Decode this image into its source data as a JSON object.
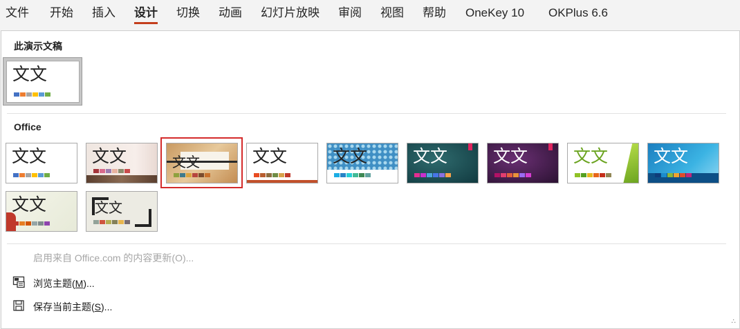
{
  "tabs": [
    "文件",
    "开始",
    "插入",
    "设计",
    "切换",
    "动画",
    "幻灯片放映",
    "审阅",
    "视图",
    "帮助",
    "OneKey 10",
    "OKPlus 6.6"
  ],
  "active_tab": "设计",
  "sections": {
    "this_presentation": "此演示文稿",
    "office": "Office"
  },
  "theme_sample_text": "文文",
  "themes": [
    {
      "name": "office-theme-default",
      "colors": [
        "#4472c4",
        "#ed7d31",
        "#a5a5a5",
        "#ffc000",
        "#5b9bd5",
        "#70ad47"
      ]
    },
    {
      "name": "theme-office-white",
      "colors": [
        "#4472c4",
        "#ed7d31",
        "#a5a5a5",
        "#ffc000",
        "#5b9bd5",
        "#70ad47"
      ]
    },
    {
      "name": "theme-wood-pink",
      "colors": [
        "#a4343a",
        "#d86a8c",
        "#9b7bb0",
        "#e8b3a0",
        "#8c8c6d",
        "#c94b4b"
      ]
    },
    {
      "name": "theme-wood-board",
      "colors": [
        "#8fa13e",
        "#3e7a8c",
        "#d9a33d",
        "#b6453d",
        "#7a4b2e",
        "#c9712c"
      ]
    },
    {
      "name": "theme-ion-boardroom",
      "colors": [
        "#e84c22",
        "#b85e2f",
        "#8c6d3f",
        "#6f8c45",
        "#d8a24a",
        "#c0392b"
      ]
    },
    {
      "name": "theme-blue-pattern",
      "colors": [
        "#1cade4",
        "#2683c6",
        "#27ced7",
        "#42ba97",
        "#3e8853",
        "#62a39f"
      ]
    },
    {
      "name": "theme-teal-dark",
      "colors": [
        "#e32d91",
        "#c830cc",
        "#4ea6dc",
        "#4775e7",
        "#8971e1",
        "#f8a24b"
      ]
    },
    {
      "name": "theme-purple-dark",
      "colors": [
        "#b31166",
        "#e33d6f",
        "#e45f3c",
        "#e9943a",
        "#9b6bf2",
        "#d53dd0"
      ]
    },
    {
      "name": "theme-green-facet",
      "colors": [
        "#90c226",
        "#54a021",
        "#e6b91e",
        "#e76618",
        "#c42f1a",
        "#918655"
      ]
    },
    {
      "name": "theme-blue-gradient",
      "colors": [
        "#0f3d7a",
        "#1c8ccd",
        "#8cb83a",
        "#f0a22e",
        "#de4c2b",
        "#c0267a"
      ]
    },
    {
      "name": "theme-savon",
      "colors": [
        "#c0392b",
        "#e67e22",
        "#d35400",
        "#95a5a6",
        "#7f8c8d",
        "#8e44ad"
      ]
    },
    {
      "name": "theme-frame-dark",
      "colors": [
        "#93a299",
        "#cf543f",
        "#b5ae53",
        "#848058",
        "#e8b54d",
        "#786c71"
      ]
    }
  ],
  "menu": {
    "enable_updates": "启用来自 Office.com 的内容更新(O)...",
    "browse_themes_prefix": "浏览主题(",
    "browse_themes_key": "M",
    "browse_themes_suffix": ")...",
    "save_theme_prefix": "保存当前主题(",
    "save_theme_key": "S",
    "save_theme_suffix": ")..."
  }
}
